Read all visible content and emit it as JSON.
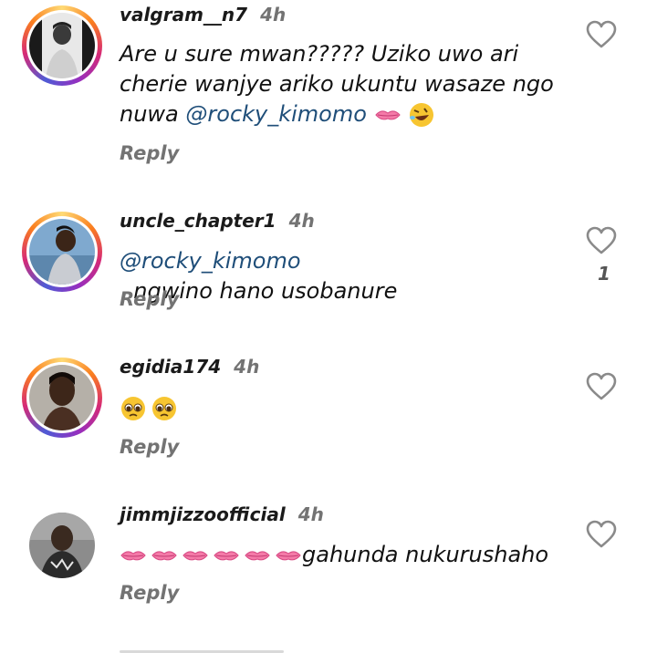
{
  "comments": [
    {
      "username": "valgram__n7",
      "time": "4h",
      "text_line1": "Are u sure mwan????? Uziko uwo ari",
      "text_line2": "cherie wanjye  ariko ukuntu wasaze ngo",
      "text_line3_prefix": "nuwa ",
      "mention": "@rocky_kimomo",
      "emojis": [
        "lips-icon",
        "rofl-face-icon"
      ],
      "reply_label": "Reply",
      "likes": ""
    },
    {
      "username": "uncle_chapter1",
      "time": "4h",
      "mention": "@rocky_kimomo",
      "text_suffix": "  ngwino hano usobanure",
      "reply_label": "Reply",
      "likes": "1"
    },
    {
      "username": "egidia174",
      "time": "4h",
      "emojis": [
        "pleading-face-icon",
        "pleading-face-icon"
      ],
      "reply_label": "Reply",
      "likes": ""
    },
    {
      "username": "jimmjizzoofficial",
      "time": "4h",
      "emojis": [
        "lips-icon",
        "lips-icon",
        "lips-icon",
        "lips-icon",
        "lips-icon",
        "lips-icon"
      ],
      "text_suffix": "gahunda nukurushaho",
      "reply_label": "Reply",
      "likes": ""
    }
  ],
  "colors": {
    "mention": "#1f4e79",
    "secondary_text": "#737373",
    "story_ring": [
      "#feda75",
      "#fa7e1e",
      "#d62976",
      "#962fbf",
      "#4f5bd5"
    ]
  }
}
